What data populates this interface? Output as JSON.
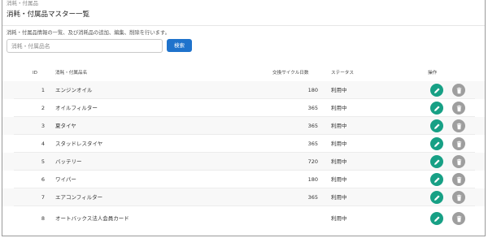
{
  "breadcrumb": "消耗・付属品",
  "page_title": "消耗・付属品マスター一覧",
  "description": "消耗・付属品情報の一覧、及び消耗品の追加、編集、削除を行います。",
  "search": {
    "placeholder": "消耗・付属品名",
    "value": "",
    "button_label": "検索"
  },
  "table": {
    "headers": {
      "id": "ID",
      "name": "消耗・付属品名",
      "days": "交換サイクル日数",
      "status": "ステータス",
      "actions": "操作"
    },
    "rows": [
      {
        "id": "1",
        "name": "エンジンオイル",
        "days": "180",
        "status": "利用中"
      },
      {
        "id": "2",
        "name": "オイルフィルター",
        "days": "365",
        "status": "利用中"
      },
      {
        "id": "3",
        "name": "夏タイヤ",
        "days": "365",
        "status": "利用中"
      },
      {
        "id": "4",
        "name": "スタッドレスタイヤ",
        "days": "365",
        "status": "利用中"
      },
      {
        "id": "5",
        "name": "バッテリー",
        "days": "720",
        "status": "利用中"
      },
      {
        "id": "6",
        "name": "ワイパー",
        "days": "180",
        "status": "利用中"
      },
      {
        "id": "7",
        "name": "エアコンフィルター",
        "days": "365",
        "status": "利用中"
      },
      {
        "id": "8",
        "name": "オートバックス法人会員カード",
        "days": "",
        "status": "利用中"
      }
    ]
  },
  "icons": {
    "edit": "pencil-icon",
    "delete": "trash-icon"
  },
  "colors": {
    "primary": "#1f73cc",
    "edit": "#17a085",
    "delete": "#9e9e9e"
  }
}
